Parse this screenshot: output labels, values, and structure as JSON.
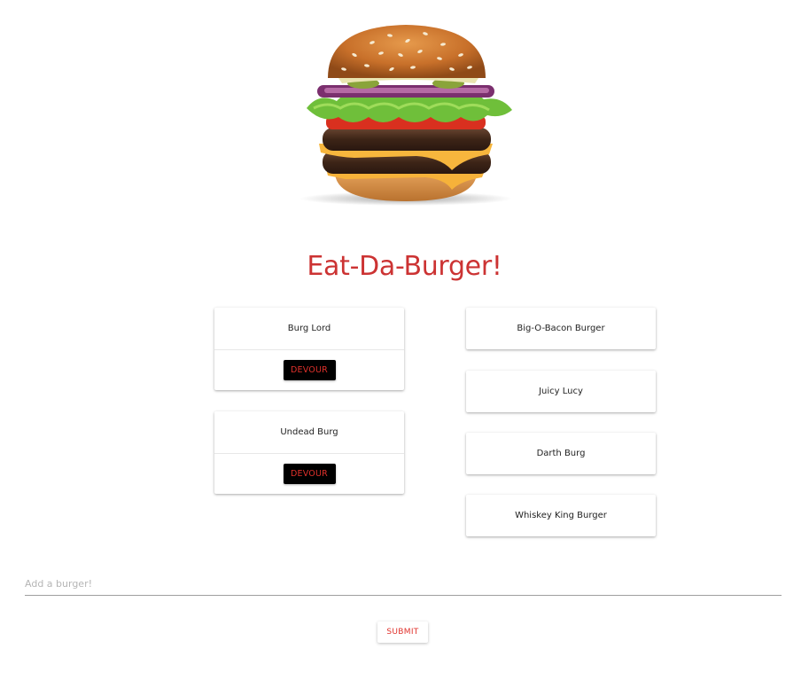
{
  "header": {
    "image_name": "burger-image",
    "title": "Eat-Da-Burger!"
  },
  "uneaten": [
    {
      "name": "Burg Lord",
      "button_label": "DEVOUR"
    },
    {
      "name": "Undead Burg",
      "button_label": "DEVOUR"
    }
  ],
  "devoured": [
    {
      "name": "Big-O-Bacon Burger"
    },
    {
      "name": "Juicy Lucy"
    },
    {
      "name": "Darth Burg"
    },
    {
      "name": "Whiskey King Burger"
    }
  ],
  "form": {
    "input_placeholder": "Add a burger!",
    "input_value": "",
    "submit_label": "SUBMIT"
  },
  "colors": {
    "title": "#cc3333",
    "button_text": "#e0312b",
    "devour_bg": "#000000"
  }
}
